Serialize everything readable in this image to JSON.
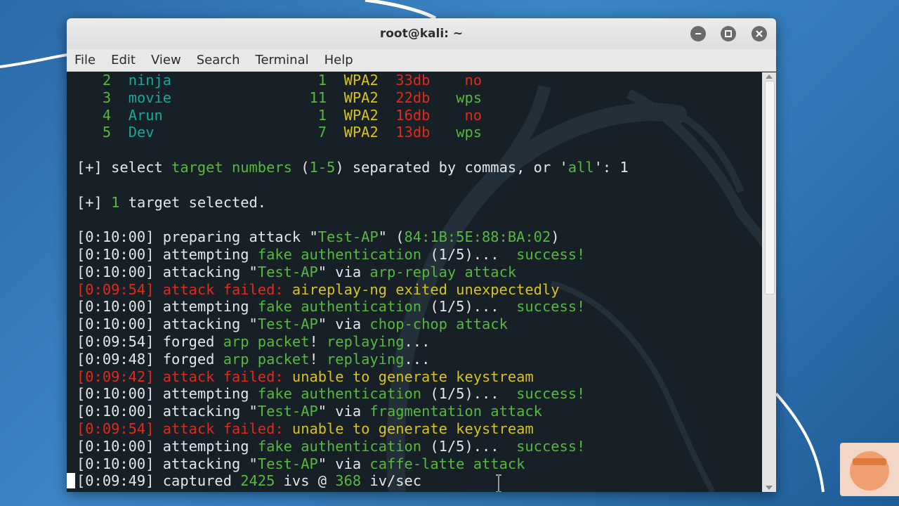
{
  "window": {
    "title": "root@kali: ~"
  },
  "menu": [
    "File",
    "Edit",
    "View",
    "Search",
    "Terminal",
    "Help"
  ],
  "terminal": {
    "lines": [
      [
        {
          "t": "   ",
          "c": "w"
        },
        {
          "t": "2",
          "c": "g"
        },
        {
          "t": "  ",
          "c": "w"
        },
        {
          "t": "ninja",
          "c": "c"
        },
        {
          "t": "                 ",
          "c": "w"
        },
        {
          "t": "1",
          "c": "g"
        },
        {
          "t": "  ",
          "c": "w"
        },
        {
          "t": "WPA2",
          "c": "y"
        },
        {
          "t": "  ",
          "c": "w"
        },
        {
          "t": "33db",
          "c": "r"
        },
        {
          "t": "    ",
          "c": "w"
        },
        {
          "t": "no",
          "c": "r"
        }
      ],
      [
        {
          "t": "   ",
          "c": "w"
        },
        {
          "t": "3",
          "c": "g"
        },
        {
          "t": "  ",
          "c": "w"
        },
        {
          "t": "movie",
          "c": "c"
        },
        {
          "t": "                ",
          "c": "w"
        },
        {
          "t": "11",
          "c": "g"
        },
        {
          "t": "  ",
          "c": "w"
        },
        {
          "t": "WPA2",
          "c": "y"
        },
        {
          "t": "  ",
          "c": "w"
        },
        {
          "t": "22db",
          "c": "r"
        },
        {
          "t": "   ",
          "c": "w"
        },
        {
          "t": "wps",
          "c": "g"
        }
      ],
      [
        {
          "t": "   ",
          "c": "w"
        },
        {
          "t": "4",
          "c": "g"
        },
        {
          "t": "  ",
          "c": "w"
        },
        {
          "t": "Arun",
          "c": "c"
        },
        {
          "t": "                  ",
          "c": "w"
        },
        {
          "t": "1",
          "c": "g"
        },
        {
          "t": "  ",
          "c": "w"
        },
        {
          "t": "WPA2",
          "c": "y"
        },
        {
          "t": "  ",
          "c": "w"
        },
        {
          "t": "16db",
          "c": "r"
        },
        {
          "t": "    ",
          "c": "w"
        },
        {
          "t": "no",
          "c": "r"
        }
      ],
      [
        {
          "t": "   ",
          "c": "w"
        },
        {
          "t": "5",
          "c": "g"
        },
        {
          "t": "  ",
          "c": "w"
        },
        {
          "t": "Dev",
          "c": "c"
        },
        {
          "t": "                   ",
          "c": "w"
        },
        {
          "t": "7",
          "c": "g"
        },
        {
          "t": "  ",
          "c": "w"
        },
        {
          "t": "WPA2",
          "c": "y"
        },
        {
          "t": "  ",
          "c": "w"
        },
        {
          "t": "13db",
          "c": "r"
        },
        {
          "t": "   ",
          "c": "w"
        },
        {
          "t": "wps",
          "c": "g"
        }
      ],
      [],
      [
        {
          "t": "[+] select ",
          "c": "w"
        },
        {
          "t": "target numbers",
          "c": "g"
        },
        {
          "t": " (",
          "c": "w"
        },
        {
          "t": "1-5",
          "c": "g"
        },
        {
          "t": ") separated by commas, or '",
          "c": "w"
        },
        {
          "t": "all",
          "c": "g"
        },
        {
          "t": "': 1",
          "c": "w"
        }
      ],
      [],
      [
        {
          "t": "[+] ",
          "c": "w"
        },
        {
          "t": "1",
          "c": "g"
        },
        {
          "t": " target selected.",
          "c": "w"
        }
      ],
      [],
      [
        {
          "t": "[0:10:00] preparing attack \"",
          "c": "w"
        },
        {
          "t": "Test-AP",
          "c": "g"
        },
        {
          "t": "\" (",
          "c": "w"
        },
        {
          "t": "84:1B:5E:88:BA:02",
          "c": "g"
        },
        {
          "t": ")",
          "c": "w"
        }
      ],
      [
        {
          "t": "[0:10:00] attempting ",
          "c": "w"
        },
        {
          "t": "fake authentication",
          "c": "g"
        },
        {
          "t": " (1/5)...  ",
          "c": "w"
        },
        {
          "t": "success!",
          "c": "g"
        }
      ],
      [
        {
          "t": "[0:10:00] attacking \"",
          "c": "w"
        },
        {
          "t": "Test-AP",
          "c": "g"
        },
        {
          "t": "\" via ",
          "c": "w"
        },
        {
          "t": "arp-replay attack",
          "c": "g"
        }
      ],
      [
        {
          "t": "[0:09:54] attack failed:",
          "c": "r"
        },
        {
          "t": " aireplay-ng exited unexpectedly",
          "c": "y"
        }
      ],
      [
        {
          "t": "[0:10:00] attempting ",
          "c": "w"
        },
        {
          "t": "fake authentication",
          "c": "g"
        },
        {
          "t": " (1/5)...  ",
          "c": "w"
        },
        {
          "t": "success!",
          "c": "g"
        }
      ],
      [
        {
          "t": "[0:10:00] attacking \"",
          "c": "w"
        },
        {
          "t": "Test-AP",
          "c": "g"
        },
        {
          "t": "\" via ",
          "c": "w"
        },
        {
          "t": "chop-chop attack",
          "c": "g"
        }
      ],
      [
        {
          "t": "[0:09:54] forged ",
          "c": "w"
        },
        {
          "t": "arp packet",
          "c": "g"
        },
        {
          "t": "! ",
          "c": "w"
        },
        {
          "t": "replaying",
          "c": "g"
        },
        {
          "t": "...",
          "c": "w"
        }
      ],
      [
        {
          "t": "[0:09:48] forged ",
          "c": "w"
        },
        {
          "t": "arp packet",
          "c": "g"
        },
        {
          "t": "! ",
          "c": "w"
        },
        {
          "t": "replaying",
          "c": "g"
        },
        {
          "t": "...",
          "c": "w"
        }
      ],
      [
        {
          "t": "[0:09:42] attack failed:",
          "c": "r"
        },
        {
          "t": " unable to generate keystream",
          "c": "y"
        }
      ],
      [
        {
          "t": "[0:10:00] attempting ",
          "c": "w"
        },
        {
          "t": "fake authentication",
          "c": "g"
        },
        {
          "t": " (1/5)...  ",
          "c": "w"
        },
        {
          "t": "success!",
          "c": "g"
        }
      ],
      [
        {
          "t": "[0:10:00] attacking \"",
          "c": "w"
        },
        {
          "t": "Test-AP",
          "c": "g"
        },
        {
          "t": "\" via ",
          "c": "w"
        },
        {
          "t": "fragmentation attack",
          "c": "g"
        }
      ],
      [
        {
          "t": "[0:09:54] attack failed:",
          "c": "r"
        },
        {
          "t": " unable to generate keystream",
          "c": "y"
        }
      ],
      [
        {
          "t": "[0:10:00] attempting ",
          "c": "w"
        },
        {
          "t": "fake authentication",
          "c": "g"
        },
        {
          "t": " (1/5)...  ",
          "c": "w"
        },
        {
          "t": "success!",
          "c": "g"
        }
      ],
      [
        {
          "t": "[0:10:00] attacking \"",
          "c": "w"
        },
        {
          "t": "Test-AP",
          "c": "g"
        },
        {
          "t": "\" via ",
          "c": "w"
        },
        {
          "t": "caffe-latte attack",
          "c": "g"
        }
      ],
      [
        {
          "t": "[0:09:49] captured ",
          "c": "w"
        },
        {
          "t": "2425",
          "c": "g"
        },
        {
          "t": " ivs @ ",
          "c": "w"
        },
        {
          "t": "368",
          "c": "g"
        },
        {
          "t": " iv/sec",
          "c": "w"
        }
      ]
    ]
  },
  "colors": {
    "terminal_bg": "#172027",
    "green": "#56b83c",
    "cyan": "#18a79a",
    "yellow": "#d7c21e",
    "red": "#e02a1a",
    "desktop": "#2f76b5"
  },
  "icons": [
    "minimize-icon",
    "maximize-icon",
    "close-icon",
    "kali-dragon-watermark",
    "text-cursor-icon"
  ]
}
